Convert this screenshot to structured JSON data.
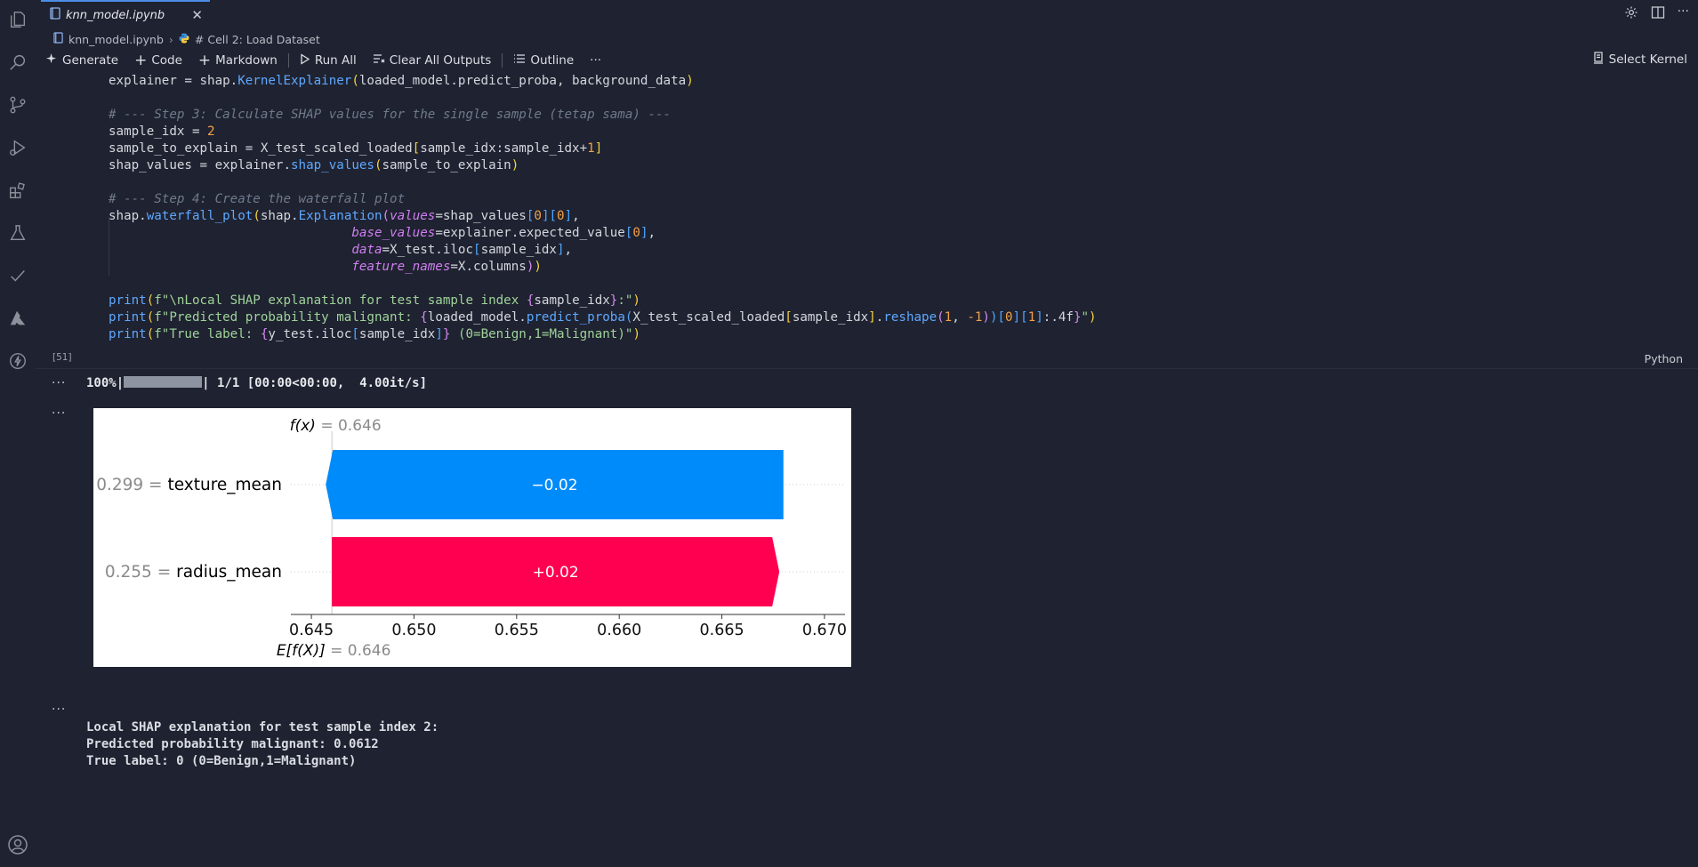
{
  "tab": {
    "filename": "knn_model.ipynb"
  },
  "breadcrumb": {
    "file": "knn_model.ipynb",
    "cell": "# Cell 2: Load Dataset"
  },
  "toolbar": {
    "generate": "Generate",
    "code": "Code",
    "markdown": "Markdown",
    "run_all": "Run All",
    "clear_outputs": "Clear All Outputs",
    "outline": "Outline",
    "more": "···",
    "kernel": "Select Kernel"
  },
  "cell": {
    "exec_count": "[51]",
    "language": "Python"
  },
  "output": {
    "dots": "···",
    "progress_pre": "100%|",
    "progress_post": "| 1/1 [00:00<00:00,  4.00it/s]",
    "lines": [
      "Local SHAP explanation for test sample index 2:",
      "Predicted probability malignant: 0.0612",
      "True label: 0 (0=Benign,1=Malignant)"
    ]
  },
  "chart_data": {
    "type": "waterfall",
    "fx_label": "f(x)",
    "fx_value": "= 0.646",
    "ex_label": "E[f(X)]",
    "ex_value": "= 0.646",
    "base_value": 0.646,
    "xlim": [
      0.644,
      0.671
    ],
    "ticks": [
      0.645,
      0.65,
      0.655,
      0.66,
      0.665,
      0.67
    ],
    "tick_labels": [
      "0.645",
      "0.650",
      "0.655",
      "0.660",
      "0.665",
      "0.670"
    ],
    "features": [
      {
        "name": "texture_mean",
        "value_label": "0.299 =",
        "contribution": -0.0203,
        "label": "−0.02",
        "start": 0.668,
        "end": 0.6457,
        "color": "#008bfb"
      },
      {
        "name": "radius_mean",
        "value_label": "0.255 =",
        "contribution": 0.0217,
        "label": "+0.02",
        "start": 0.646,
        "end": 0.6678,
        "color": "#ff0051"
      }
    ]
  },
  "colors": {
    "positive": "#ff0051",
    "negative": "#008bfb",
    "accent": "#4c8de8"
  }
}
